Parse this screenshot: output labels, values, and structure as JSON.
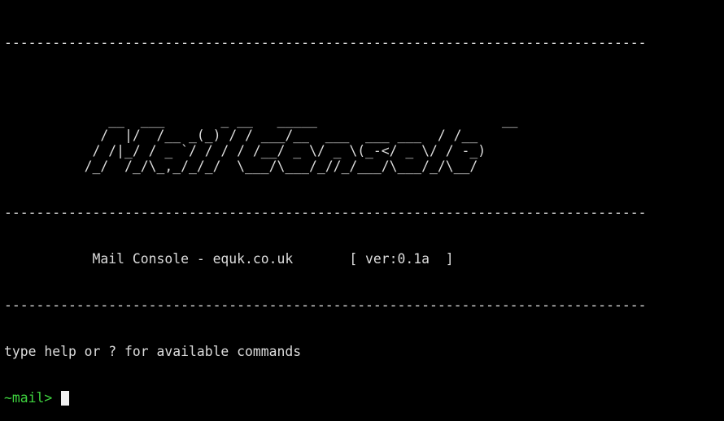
{
  "terminal": {
    "divider": "--------------------------------------------------------------------------------",
    "ascii_art": "\n\n             __  ___       _ __   _____                       __\n            /  |/  /__ _(_) / / ___/__  ___  ___ ___  / /__\n           / /|_/ / _ `/ / / / /__/ _ \\/ _ \\(_-</ _ \\/ / -_)\n          /_/  /_/\\_,_/_/_/  \\___/\\___/_//_/___/\\___/_/\\__/\n",
    "title_line": "           Mail Console - equk.co.uk       [ ver:0.1a  ]",
    "help_text": "type help or ? for available commands",
    "prompt": "~mail> ",
    "input_value": "",
    "colors": {
      "background": "#000000",
      "foreground": "#dcdcdc",
      "prompt": "#3fd43f",
      "cursor": "#f2f2f2"
    }
  }
}
